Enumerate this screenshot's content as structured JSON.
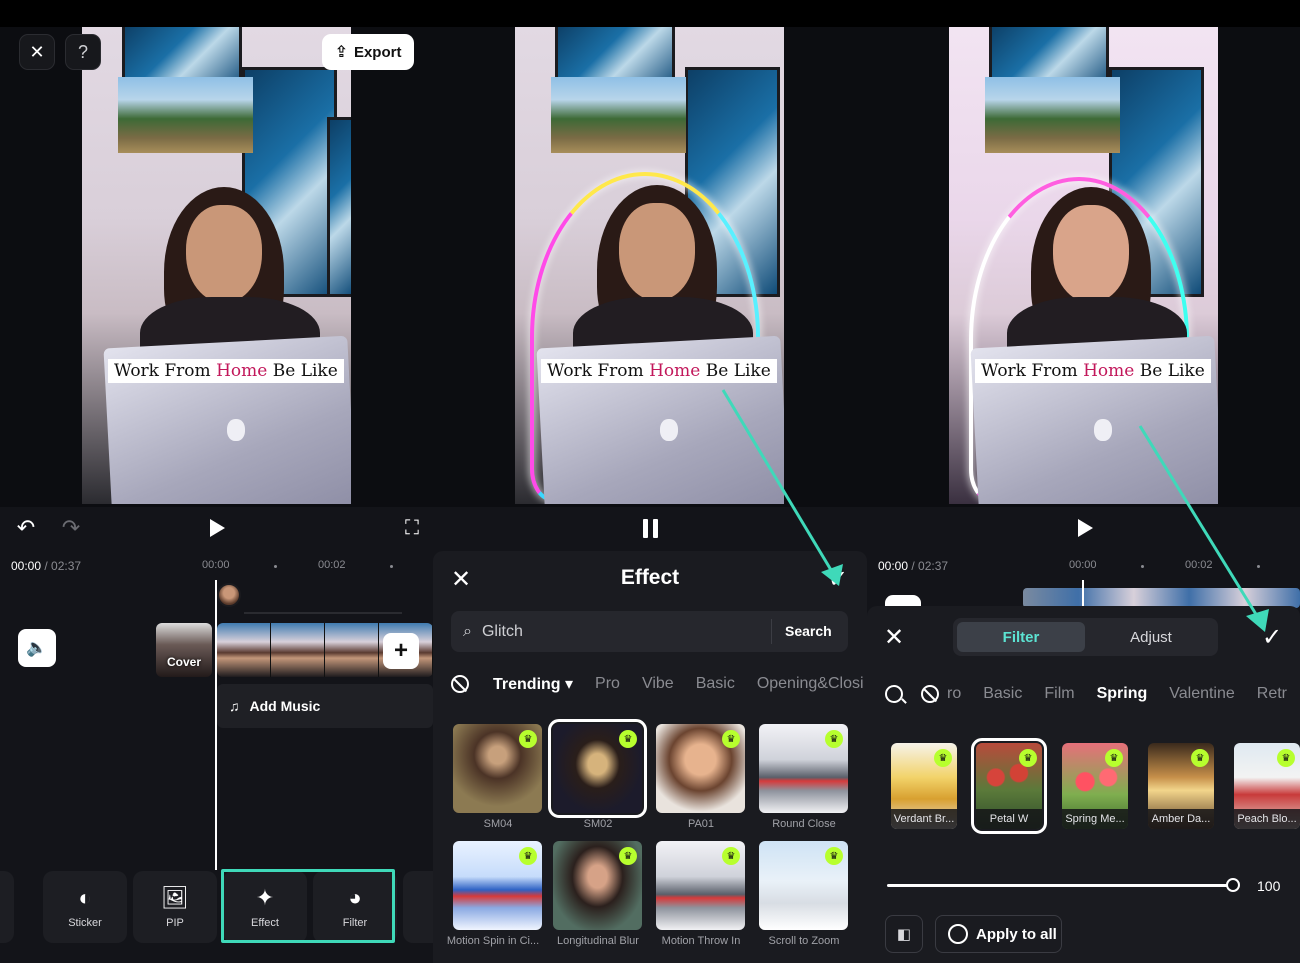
{
  "colors": {
    "accent": "#3fd9b9",
    "crown": "#b7ff2e",
    "filter_tab": "#5ce3d2",
    "caption_highlight": "#c2185b"
  },
  "video": {
    "caption_before": "Work From ",
    "caption_highlight": "Home",
    "caption_after": " Be Like"
  },
  "editor": {
    "export_label": "Export",
    "help_label": "?",
    "close_icon": "close-icon",
    "time_current": "00:00",
    "time_total": "/ 02:37",
    "ticks": [
      "00:00",
      "00:02"
    ],
    "cover_label": "Cover",
    "add_music_label": "Add Music",
    "tools": [
      {
        "label": "Sticker",
        "icon": "sticker-icon"
      },
      {
        "label": "PIP",
        "icon": "pip-icon"
      },
      {
        "label": "Effect",
        "icon": "effect-icon"
      },
      {
        "label": "Filter",
        "icon": "filter-icon"
      }
    ]
  },
  "effect_panel": {
    "title": "Effect",
    "search_value": "Glitch",
    "search_button": "Search",
    "categories": [
      "Trending",
      "Pro",
      "Vibe",
      "Basic",
      "Opening&Closi"
    ],
    "active_category": "Trending",
    "tiles": [
      {
        "label": "SM04",
        "premium": true,
        "selected": false
      },
      {
        "label": "SM02",
        "premium": true,
        "selected": true
      },
      {
        "label": "PA01",
        "premium": true,
        "selected": false
      },
      {
        "label": "Round Close",
        "premium": true,
        "selected": false
      },
      {
        "label": "Motion Spin in Ci...",
        "premium": true,
        "selected": false
      },
      {
        "label": "Longitudinal Blur",
        "premium": true,
        "selected": false
      },
      {
        "label": "Motion Throw In",
        "premium": true,
        "selected": false
      },
      {
        "label": "Scroll to Zoom",
        "premium": true,
        "selected": false
      }
    ]
  },
  "filter_panel": {
    "tabs": [
      "Filter",
      "Adjust"
    ],
    "active_tab": "Filter",
    "time_current": "00:00",
    "time_total": "/ 02:37",
    "ticks": [
      "00:00",
      "00:02"
    ],
    "categories": [
      "ro",
      "Basic",
      "Film",
      "Spring",
      "Valentine",
      "Retr"
    ],
    "active_category": "Spring",
    "tiles": [
      {
        "label": "Verdant Br...",
        "selected": false
      },
      {
        "label": "Petal W",
        "selected": true
      },
      {
        "label": "Spring Me...",
        "selected": false
      },
      {
        "label": "Amber Da...",
        "selected": false
      },
      {
        "label": "Peach Blo...",
        "selected": false
      }
    ],
    "intensity": 100,
    "intensity_label": "100",
    "apply_all_label": "Apply to all"
  }
}
